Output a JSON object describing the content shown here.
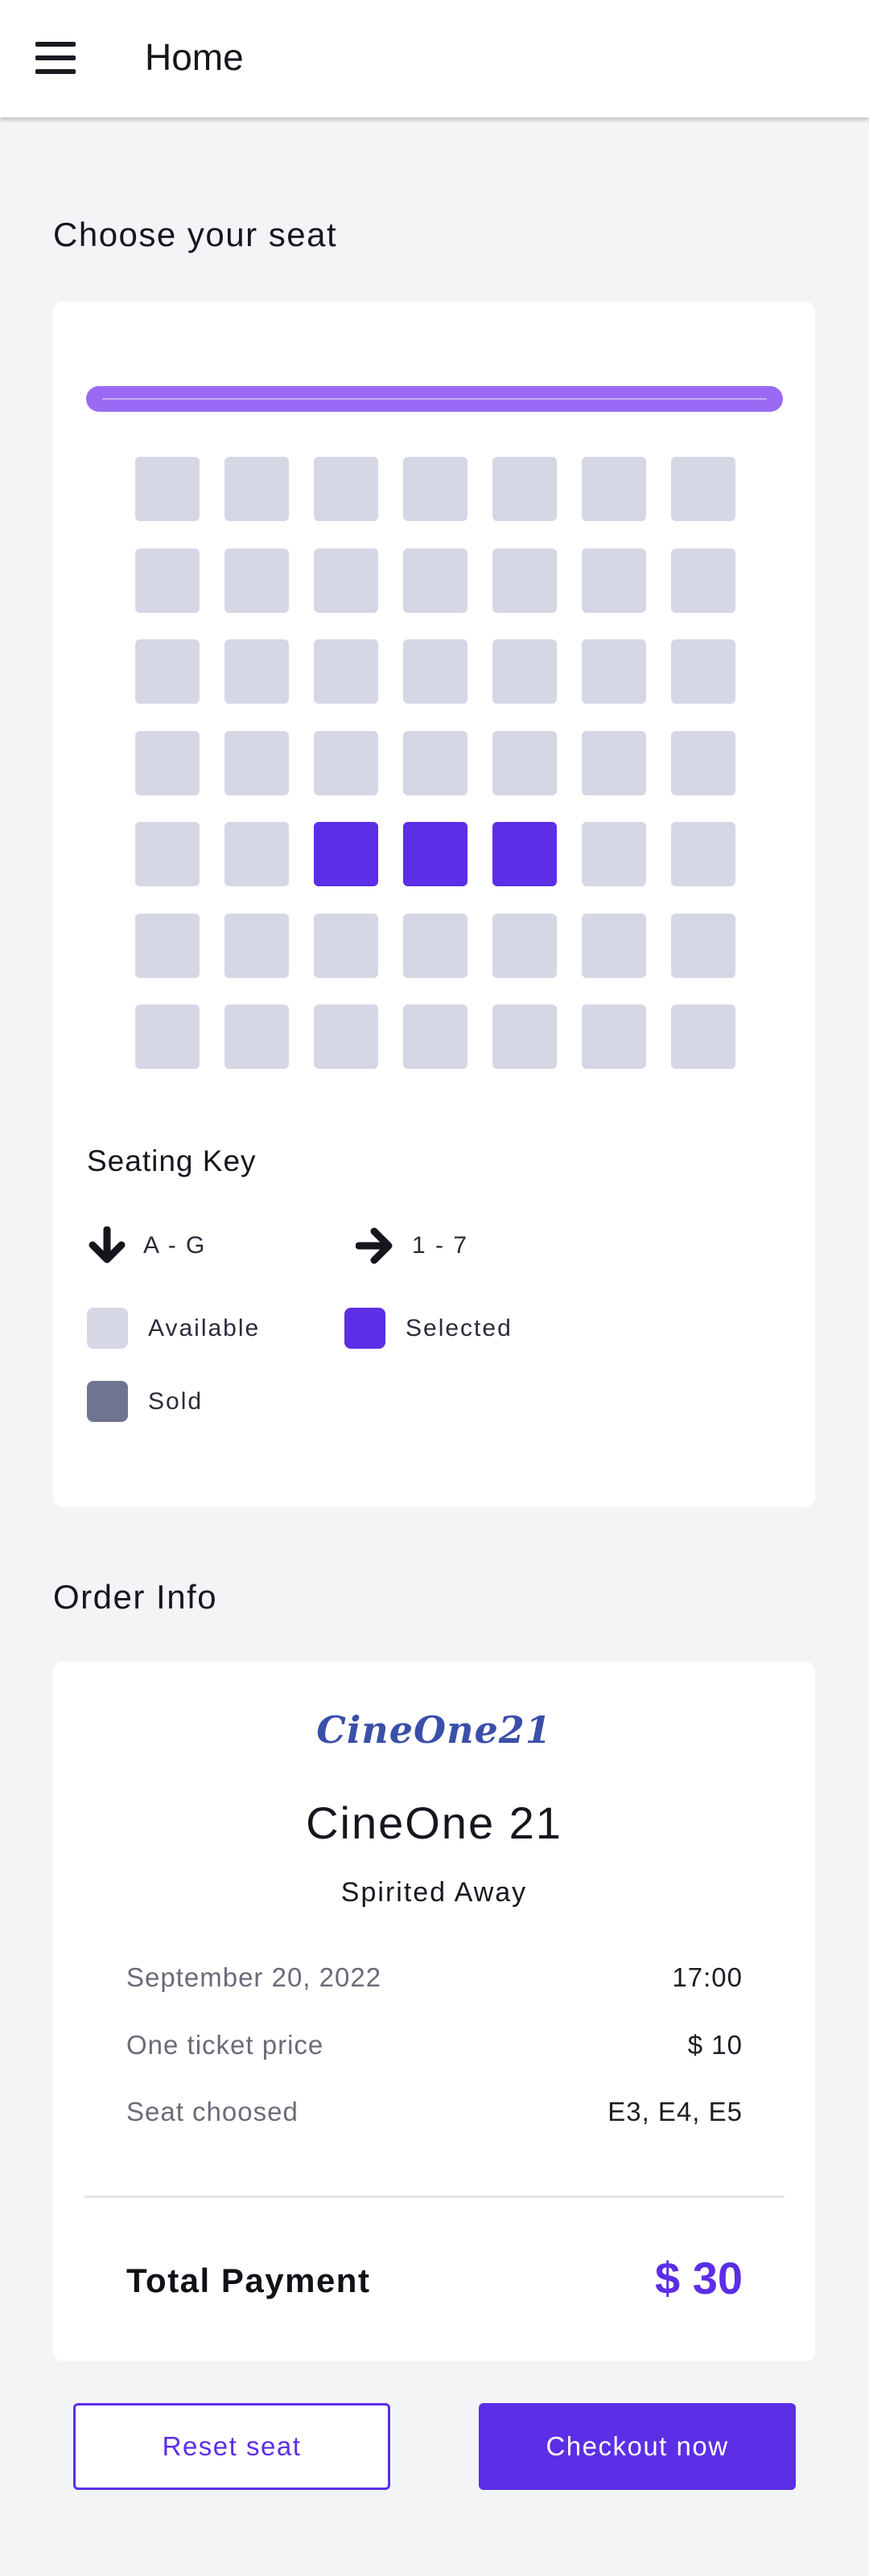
{
  "header": {
    "title": "Home",
    "menu_icon": "hamburger-menu-icon"
  },
  "seat_section": {
    "title": "Choose your seat",
    "rows": 7,
    "cols": 7,
    "selected": [
      [
        4,
        2
      ],
      [
        4,
        3
      ],
      [
        4,
        4
      ]
    ],
    "sold": []
  },
  "seating_key": {
    "title": "Seating Key",
    "rows_label": "A - G",
    "cols_label": "1 - 7",
    "available": "Available",
    "selected": "Selected",
    "sold": "Sold"
  },
  "colors": {
    "accent": "#5c2ee6",
    "available": "#d5d7e5",
    "sold": "#6f7492",
    "screen": "#9a6af5"
  },
  "order": {
    "title": "Order Info",
    "logo_text": "CineOne21",
    "cinema": "CineOne 21",
    "movie": "Spirited Away",
    "date": "September 20, 2022",
    "time": "17:00",
    "ticket_price_label": "One ticket price",
    "ticket_price": "$ 10",
    "seat_label": "Seat choosed",
    "seats": "E3, E4, E5",
    "total_label": "Total Payment",
    "total": "$ 30"
  },
  "actions": {
    "reset": "Reset seat",
    "checkout": "Checkout now"
  }
}
